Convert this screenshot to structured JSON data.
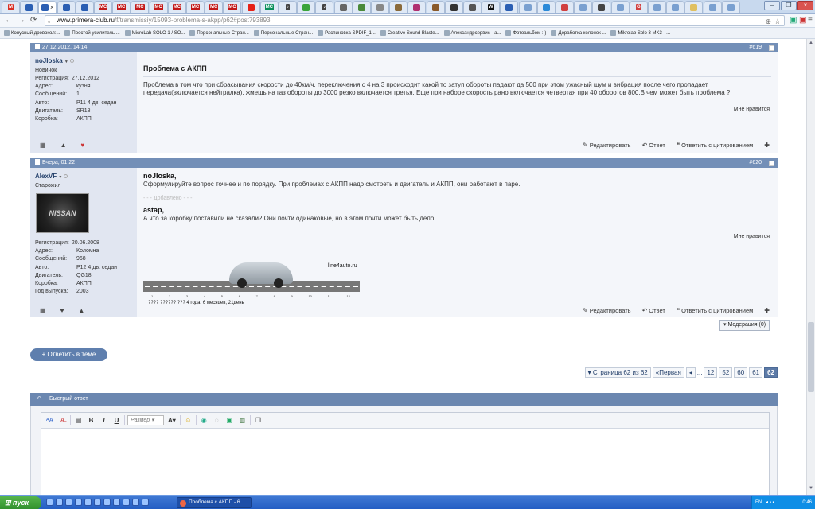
{
  "browser": {
    "tabs": [
      {
        "icon": "gmail-icon",
        "color": "#d93025",
        "label": "M",
        "active": false
      },
      {
        "icon": "site-icon",
        "color": "#2b5fb3",
        "label": "",
        "active": false
      },
      {
        "icon": "site-icon",
        "color": "#2b5fb3",
        "label": "",
        "active": true
      },
      {
        "icon": "site-icon",
        "color": "#2b5fb3",
        "label": "",
        "active": false
      },
      {
        "icon": "site-icon",
        "color": "#2b5fb3",
        "label": "",
        "active": false
      },
      {
        "icon": "mc-icon",
        "color": "#c21818",
        "label": "MC",
        "active": false
      },
      {
        "icon": "mc-icon",
        "color": "#c21818",
        "label": "MC",
        "active": false
      },
      {
        "icon": "mc-icon",
        "color": "#c21818",
        "label": "MC",
        "active": false
      },
      {
        "icon": "mc-icon",
        "color": "#c21818",
        "label": "MC",
        "active": false
      },
      {
        "icon": "mc-icon",
        "color": "#c21818",
        "label": "MC",
        "active": false
      },
      {
        "icon": "mc-icon",
        "color": "#c21818",
        "label": "MC",
        "active": false
      },
      {
        "icon": "mc-icon",
        "color": "#c21818",
        "label": "MC",
        "active": false
      },
      {
        "icon": "mc-icon",
        "color": "#c21818",
        "label": "MC",
        "active": false
      },
      {
        "icon": "youtube-icon",
        "color": "#e62117",
        "label": "",
        "active": false
      },
      {
        "icon": "mc-icon",
        "color": "#0a8f5a",
        "label": "MC",
        "active": false
      },
      {
        "icon": "music-icon",
        "color": "#444444",
        "label": "♪",
        "active": false
      },
      {
        "icon": "site-icon",
        "color": "#3aa43a",
        "label": "",
        "active": false
      },
      {
        "icon": "music-icon",
        "color": "#444444",
        "label": "♪",
        "active": false
      },
      {
        "icon": "site-icon",
        "color": "#666666",
        "label": "",
        "active": false
      },
      {
        "icon": "site-icon",
        "color": "#4a8a3a",
        "label": "",
        "active": false
      },
      {
        "icon": "site-icon",
        "color": "#888888",
        "label": "",
        "active": false
      },
      {
        "icon": "site-icon",
        "color": "#8a6a3a",
        "label": "",
        "active": false
      },
      {
        "icon": "site-icon",
        "color": "#b03070",
        "label": "",
        "active": false
      },
      {
        "icon": "site-icon",
        "color": "#8a5a2a",
        "label": "",
        "active": false
      },
      {
        "icon": "site-icon",
        "color": "#333333",
        "label": "",
        "active": false
      },
      {
        "icon": "site-icon",
        "color": "#555555",
        "label": "",
        "active": false
      },
      {
        "icon": "wiki-icon",
        "color": "#111111",
        "label": "W",
        "active": false
      },
      {
        "icon": "site-icon",
        "color": "#2b5fb3",
        "label": "",
        "active": false
      },
      {
        "icon": "site-icon",
        "color": "#7aa0d0",
        "label": "",
        "active": false
      },
      {
        "icon": "site-icon",
        "color": "#2b8ad8",
        "label": "",
        "active": false
      },
      {
        "icon": "site-icon",
        "color": "#d04040",
        "label": "",
        "active": false
      },
      {
        "icon": "site-icon",
        "color": "#7aa0d0",
        "label": "",
        "active": false
      },
      {
        "icon": "site-icon",
        "color": "#444444",
        "label": "",
        "active": false
      },
      {
        "icon": "site-icon",
        "color": "#7aa0d0",
        "label": "",
        "active": false
      },
      {
        "icon": "site-icon",
        "color": "#d04040",
        "label": "G",
        "active": false
      },
      {
        "icon": "site-icon",
        "color": "#7aa0d0",
        "label": "",
        "active": false
      },
      {
        "icon": "site-icon",
        "color": "#7aa0d0",
        "label": "",
        "active": false
      },
      {
        "icon": "site-icon",
        "color": "#e0c060",
        "label": "",
        "active": false
      },
      {
        "icon": "site-icon",
        "color": "#7aa0d0",
        "label": "",
        "active": false
      },
      {
        "icon": "site-icon",
        "color": "#7aa0d0",
        "label": "",
        "active": false
      }
    ],
    "url_host": "www.primera-club.ru",
    "url_path": "/f/transmissiy/15093-problema-s-akpp/p62#post793893",
    "bookmarks": [
      "Конусный дровокол:...",
      "Простой усилитель ...",
      "MicroLab SOLO 1 / SO...",
      "Персональные Стран...",
      "Персональные Стран...",
      "Распиновка SPDIF_1...",
      "Creative Sound Blaste...",
      "Александрсервис - а...",
      "Фотоальбом :-)",
      "Доработка колонок ...",
      "Mikrolab Solo 3 MK3 - ..."
    ]
  },
  "posts": [
    {
      "date": "27.12.2012, 14:14",
      "number": "#619",
      "author": "noJIoska",
      "rank": "Новичок",
      "info": [
        {
          "label": "Регистрация:",
          "value": "27.12.2012"
        },
        {
          "label": "Адрес:",
          "value": "кузня"
        },
        {
          "label": "Сообщений:",
          "value": "1"
        },
        {
          "label": "Авто:",
          "value": "P11 4 дв. седан"
        },
        {
          "label": "Двигатель:",
          "value": "SR18"
        },
        {
          "label": "Коробка:",
          "value": "АКПП"
        }
      ],
      "title": "Проблема с АКПП",
      "body": "Проблема в том что при сбрасывания скорости до 40км/ч, переключения с 4 на 3 происходит какой то затуп обороты падают да 500 при этом ужасный шум и вибрация после чего пропадает передача(включается нейтралка), жмешь на газ обороты до 3000 резко включается третья. Еще при наборе скорость рано включается четвертая при 40 оборотов 800.В чем может быть проблема ?",
      "like": "Мне нравится"
    },
    {
      "date": "Вчера, 01:22",
      "number": "#620",
      "author": "AlexVF",
      "rank": "Старожил",
      "avatar_text": "NISSAN",
      "info": [
        {
          "label": "Регистрация:",
          "value": "20.06.2008"
        },
        {
          "label": "Адрес:",
          "value": "Коломна"
        },
        {
          "label": "Сообщений:",
          "value": "968"
        },
        {
          "label": "Авто:",
          "value": "P12 4 дв. седан"
        },
        {
          "label": "Двигатель:",
          "value": "QG18"
        },
        {
          "label": "Коробка:",
          "value": "АКПП"
        },
        {
          "label": "Год выпуска:",
          "value": "2003"
        }
      ],
      "quote1_user": "noJIoska",
      "quote1_text": "Сформулируйте вопрос точнее и по порядку. При проблемах с АКПП надо смотреть и двигатель и АКПП, они работают в паре.",
      "added": "- - - Добавлено - - -",
      "quote2_user": "astap",
      "quote2_text": "А что за коробку поставили не сказали? Они почти одинаковые, но в этом почти может быть дело.",
      "like": "Мне нравится",
      "sig_brand": "line4auto.ru",
      "sig_ticks": [
        "1",
        "2",
        "3",
        "4",
        "5",
        "6",
        "7",
        "8",
        "9",
        "10",
        "11",
        "12"
      ],
      "sig_caption": "???? ?????? ??? 4 года, 6 месяцев, 21день"
    }
  ],
  "actions": {
    "edit": "Редактировать",
    "reply": "Ответ",
    "quote": "Ответить с цитированием"
  },
  "moderation": "Модерация (0)",
  "reply_thread": "Ответить в теме",
  "pagination": {
    "label": "Страница 62 из 62",
    "first": "Первая",
    "prev": "◂",
    "ellipsis": "...",
    "pages": [
      "12",
      "52",
      "60",
      "61",
      "62"
    ],
    "current": "62"
  },
  "quick_reply": {
    "title": "Быстрый ответ",
    "size_placeholder": "Размер"
  },
  "taskbar": {
    "start": "пуск",
    "window": "Проблема с АКПП - 6...",
    "lang": "EN",
    "clock": "0:46"
  }
}
